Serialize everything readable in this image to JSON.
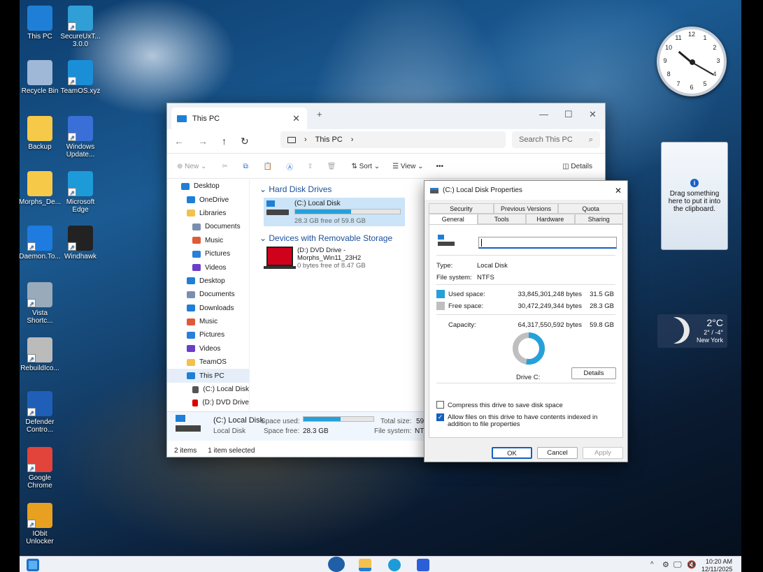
{
  "desktop": {
    "icons": [
      {
        "label": "This PC",
        "color": "#1f7fd6"
      },
      {
        "label": "SecureUxT...\n3.0.0",
        "color": "#2f9fd6"
      },
      {
        "label": "Recycle Bin",
        "color": "#9fb8d8"
      },
      {
        "label": "TeamOS.xyz",
        "color": "#1a8fd8"
      },
      {
        "label": "Backup",
        "color": "#f7c948"
      },
      {
        "label": "Windows\nUpdate...",
        "color": "#3a6fd8"
      },
      {
        "label": "Morphs_De...",
        "color": "#f7c948"
      },
      {
        "label": "Microsoft\nEdge",
        "color": "#1d9bd8"
      },
      {
        "label": "Daemon.To...",
        "color": "#1e7be0"
      },
      {
        "label": "Windhawk",
        "color": "#222222"
      },
      {
        "label": "Vista\nShortc...",
        "color": "#9ab"
      },
      {
        "label": "RebuildIco...",
        "color": "#bbb"
      },
      {
        "label": "Defender\nContro...",
        "color": "#1f5fb8"
      },
      {
        "label": "Google\nChrome",
        "color": "#e2443b"
      },
      {
        "label": "IObit\nUnlocker",
        "color": "#e8a020"
      }
    ]
  },
  "clock": {
    "numbers": [
      "12",
      "1",
      "2",
      "3",
      "4",
      "5",
      "6",
      "7",
      "8",
      "9",
      "10",
      "11"
    ]
  },
  "clipboard": {
    "text": "Drag something here to put it into the clipboard."
  },
  "weather": {
    "temp": "2°C",
    "range": "2° / -4°",
    "city": "New York"
  },
  "explorer": {
    "tab_title": "This PC",
    "breadcrumb": "This PC",
    "search_placeholder": "Search This PC",
    "toolbar": {
      "new": "New",
      "sort": "Sort",
      "view": "View",
      "more": "•••",
      "details": "Details"
    },
    "nav": [
      {
        "label": "Desktop",
        "indent": 0,
        "color": "#1f7fd6"
      },
      {
        "label": "OneDrive",
        "indent": 1,
        "color": "#1f7fd6"
      },
      {
        "label": "Libraries",
        "indent": 1,
        "color": "#f2c14e"
      },
      {
        "label": "Documents",
        "indent": 2,
        "color": "#7a8fb0"
      },
      {
        "label": "Music",
        "indent": 2,
        "color": "#e05a3a"
      },
      {
        "label": "Pictures",
        "indent": 2,
        "color": "#2a7fd6"
      },
      {
        "label": "Videos",
        "indent": 2,
        "color": "#6a3fc8"
      },
      {
        "label": "Desktop",
        "indent": 1,
        "color": "#1f7fd6"
      },
      {
        "label": "Documents",
        "indent": 1,
        "color": "#7a8fb0"
      },
      {
        "label": "Downloads",
        "indent": 1,
        "color": "#1f7fd6"
      },
      {
        "label": "Music",
        "indent": 1,
        "color": "#e05a3a"
      },
      {
        "label": "Pictures",
        "indent": 1,
        "color": "#2a7fd6"
      },
      {
        "label": "Videos",
        "indent": 1,
        "color": "#6a3fc8"
      },
      {
        "label": "TeamOS",
        "indent": 1,
        "color": "#f2c14e"
      },
      {
        "label": "This PC",
        "indent": 1,
        "color": "#1f7fd6"
      },
      {
        "label": "(C:) Local Disk",
        "indent": 2,
        "color": "#555"
      },
      {
        "label": "(D:) DVD Drive",
        "indent": 2,
        "color": "#d00"
      }
    ],
    "sections": {
      "hdd": "Hard Disk Drives",
      "removable": "Devices with Removable Storage"
    },
    "drive_c": {
      "name": "(C:) Local Disk",
      "free": "28.3 GB free of 59.8 GB",
      "used_fraction": 0.53
    },
    "drive_d": {
      "name1": "(D:) DVD Drive -",
      "name2": "Morphs_Win11_23H2",
      "free": "0 bytes free of 8.47 GB"
    },
    "details": {
      "name": "(C:) Local Disk",
      "type": "Local Disk",
      "space_used_label": "Space used:",
      "space_free_label": "Space free:",
      "space_free": "28.3 GB",
      "total_size_label": "Total size:",
      "total_size": "59.",
      "filesystem_label": "File system:",
      "filesystem": "NT"
    },
    "status": {
      "items": "2 items",
      "selected": "1 item selected"
    }
  },
  "props": {
    "title": "(C:) Local Disk Properties",
    "tabs_row1": [
      "Security",
      "Previous Versions",
      "Quota"
    ],
    "tabs_row2": [
      "General",
      "Tools",
      "Hardware",
      "Sharing"
    ],
    "type_label": "Type:",
    "type": "Local Disk",
    "fs_label": "File system:",
    "fs": "NTFS",
    "used_label": "Used space:",
    "used_bytes": "33,845,301,248 bytes",
    "used_gb": "31.5 GB",
    "free_label": "Free space:",
    "free_bytes": "30,472,249,344 bytes",
    "free_gb": "28.3 GB",
    "cap_label": "Capacity:",
    "cap_bytes": "64,317,550,592 bytes",
    "cap_gb": "59.8 GB",
    "used_fraction": 0.526,
    "drive_label": "Drive C:",
    "details_btn": "Details",
    "compress": "Compress this drive to save disk space",
    "index": "Allow files on this drive to have contents indexed in addition to file properties",
    "ok": "OK",
    "cancel": "Cancel",
    "apply": "Apply",
    "colors": {
      "used": "#26a0da",
      "free": "#bfbfbf"
    }
  },
  "taskbar": {
    "time": "10:20 AM",
    "date": "12/11/2025"
  }
}
